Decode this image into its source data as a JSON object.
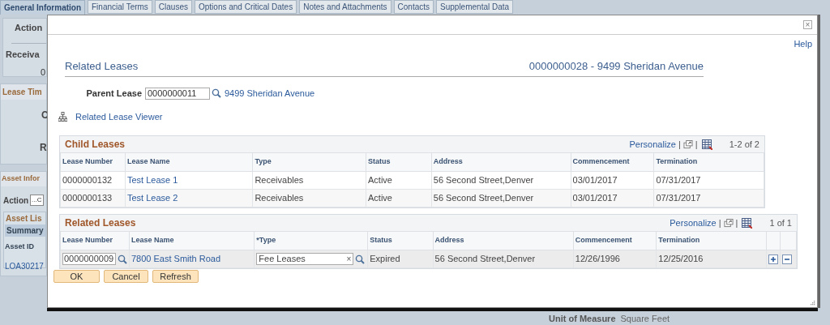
{
  "tabs": [
    {
      "label": "General Information",
      "selected": true
    },
    {
      "label": "Financial Terms",
      "selected": false
    },
    {
      "label": "Clauses",
      "selected": false
    },
    {
      "label": "Options and Critical Dates",
      "selected": false
    },
    {
      "label": "Notes and Attachments",
      "selected": false
    },
    {
      "label": "Contacts",
      "selected": false
    },
    {
      "label": "Supplemental Data",
      "selected": false
    }
  ],
  "background": {
    "action_label": "Action",
    "receivable_label": "Receiva",
    "receivable_value": "0",
    "lease_time_header": "Lease Tim",
    "lease_time_labels": [
      "C",
      "R"
    ],
    "asset_header": "Asset Infor",
    "asset_action_label": "Action",
    "asset_action_button": "...C",
    "asset_list_header": "Asset Lis",
    "asset_list_tab": "Summary",
    "asset_id_header": "Asset ID",
    "asset_id_value": "LOA30217",
    "unit_of_measure_label": "Unit of Measure",
    "unit_of_measure_value": "Square Feet"
  },
  "dialog": {
    "close": "×",
    "help": "Help",
    "title": "Related Leases",
    "subtitle": "0000000028 - 9499 Sheridan Avenue",
    "parent_lease": {
      "label": "Parent Lease",
      "value": "0000000011",
      "description": "9499 Sheridan Avenue"
    },
    "viewer_link": "Related Lease Viewer",
    "child_leases": {
      "title": "Child Leases",
      "personalize": "Personalize",
      "separator": "|",
      "range": "1-2 of 2",
      "columns": [
        "Lease Number",
        "Lease Name",
        "Type",
        "Status",
        "Address",
        "Commencement",
        "Termination"
      ],
      "rows": [
        [
          {
            "kind": "text",
            "text": "0000000132"
          },
          {
            "kind": "link",
            "text": "Test Lease 1"
          },
          {
            "kind": "text",
            "text": "Receivables"
          },
          {
            "kind": "text",
            "text": "Active"
          },
          {
            "kind": "text",
            "text": "56 Second Street,Denver"
          },
          {
            "kind": "text",
            "text": "03/01/2017"
          },
          {
            "kind": "text",
            "text": "07/31/2017"
          }
        ],
        [
          {
            "kind": "text",
            "text": "0000000133"
          },
          {
            "kind": "link",
            "text": "Test Lease 2"
          },
          {
            "kind": "text",
            "text": "Receivables"
          },
          {
            "kind": "text",
            "text": "Active"
          },
          {
            "kind": "text",
            "text": "56 Second Street,Denver"
          },
          {
            "kind": "text",
            "text": "03/01/2017"
          },
          {
            "kind": "text",
            "text": "07/31/2017"
          }
        ]
      ]
    },
    "related_leases": {
      "title": "Related Leases",
      "personalize": "Personalize",
      "separator": "|",
      "range": "1 of 1",
      "columns": [
        "Lease Number",
        "Lease Name",
        "*Type",
        "Status",
        "Address",
        "Commencement",
        "Termination"
      ],
      "rows": [
        [
          {
            "kind": "lookup",
            "value": "0000000009"
          },
          {
            "kind": "link",
            "text": "7800 East Smith Road"
          },
          {
            "kind": "combo",
            "value": "Fee Leases",
            "clear": "×"
          },
          {
            "kind": "text",
            "text": "Expired"
          },
          {
            "kind": "text",
            "text": "56 Second Street,Denver"
          },
          {
            "kind": "text",
            "text": "12/26/1996"
          },
          {
            "kind": "text",
            "text": "12/25/2016"
          },
          {
            "kind": "add"
          },
          {
            "kind": "delete"
          }
        ]
      ]
    },
    "buttons": [
      "OK",
      "Cancel",
      "Refresh"
    ]
  }
}
